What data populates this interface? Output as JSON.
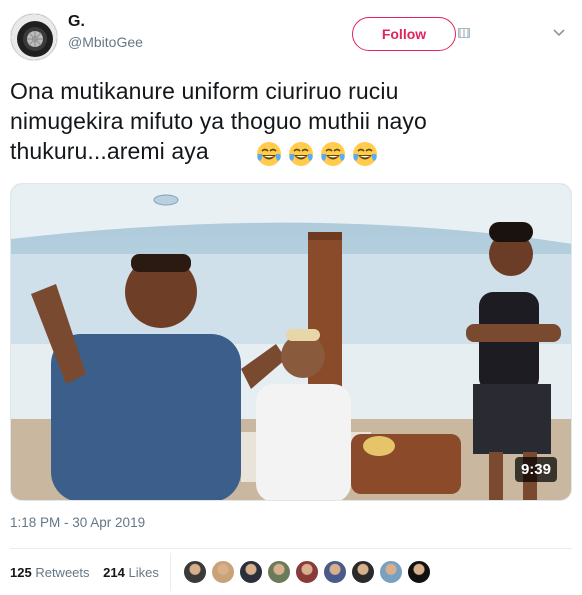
{
  "tweet": {
    "author_name": "G.",
    "author_handle": "@MbitoGee",
    "follow_label": "Follow",
    "text_lines": [
      "Ona mutikanure uniform ciuriruo ruciu",
      "nimugekira mifuto ya thoguo muthii nayo",
      "thukuru...aremi aya"
    ],
    "emoji": [
      "face-with-tears-of-joy",
      "face-with-tears-of-joy",
      "face-with-tears-of-joy",
      "face-with-tears-of-joy"
    ],
    "media": {
      "type": "video",
      "duration": "9:39"
    },
    "timestamp": "1:18 PM - 30 Apr 2019",
    "retweets_count": "125",
    "retweets_label": "Retweets",
    "likes_count": "214",
    "likes_label": "Likes",
    "liker_avatars": 9
  },
  "colors": {
    "follow_accent": "#e0245e",
    "secondary_text": "#657786",
    "primary_text": "#14171a",
    "divider": "#e6ecf0"
  }
}
